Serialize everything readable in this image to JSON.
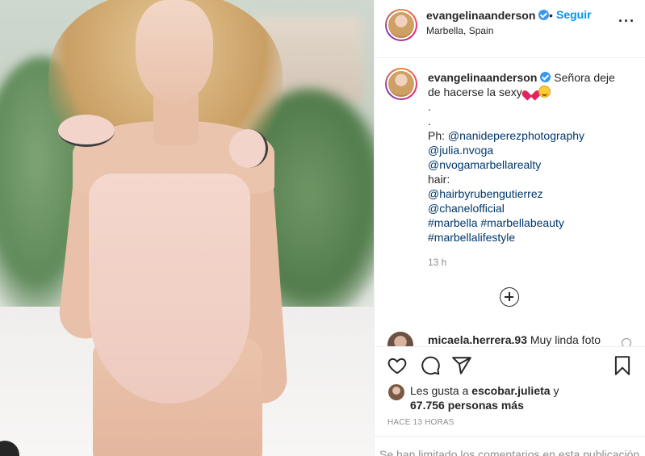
{
  "post": {
    "username": "evangelinaanderson",
    "separator": "•",
    "follow_label": "Seguir",
    "location": "Marbella, Spain",
    "more_icon": "more-options-icon"
  },
  "caption": {
    "username": "evangelinaanderson",
    "text": "Señora deje de hacerse la sexy",
    "dots": [
      ".",
      "."
    ],
    "ph_label": "Ph:",
    "ph_link": "@nanideperezphotography",
    "links1": [
      "@julia.nvoga",
      "@nvogamarbellarealty"
    ],
    "hair_label": "hair:",
    "links2": [
      "@hairbyrubengutierrez",
      "@chanelofficial"
    ],
    "hashtags_line1": "#marbella #marbellabeauty",
    "hashtags_line2": "#marbellalifestyle",
    "time": "13 h"
  },
  "comment": {
    "username": "micaela.herrera.93",
    "text": "Muy linda foto"
  },
  "actions": {
    "like_icon": "heart-icon",
    "comment_icon": "comment-icon",
    "share_icon": "share-icon",
    "save_icon": "bookmark-icon"
  },
  "likes": {
    "prefix": "Les gusta a",
    "user": "escobar.julieta",
    "conj": "y",
    "count": "67.756 personas más"
  },
  "posted_ago": "HACE 13 HORAS",
  "comments_limited": "Se han limitado los comentarios en esta publicación"
}
